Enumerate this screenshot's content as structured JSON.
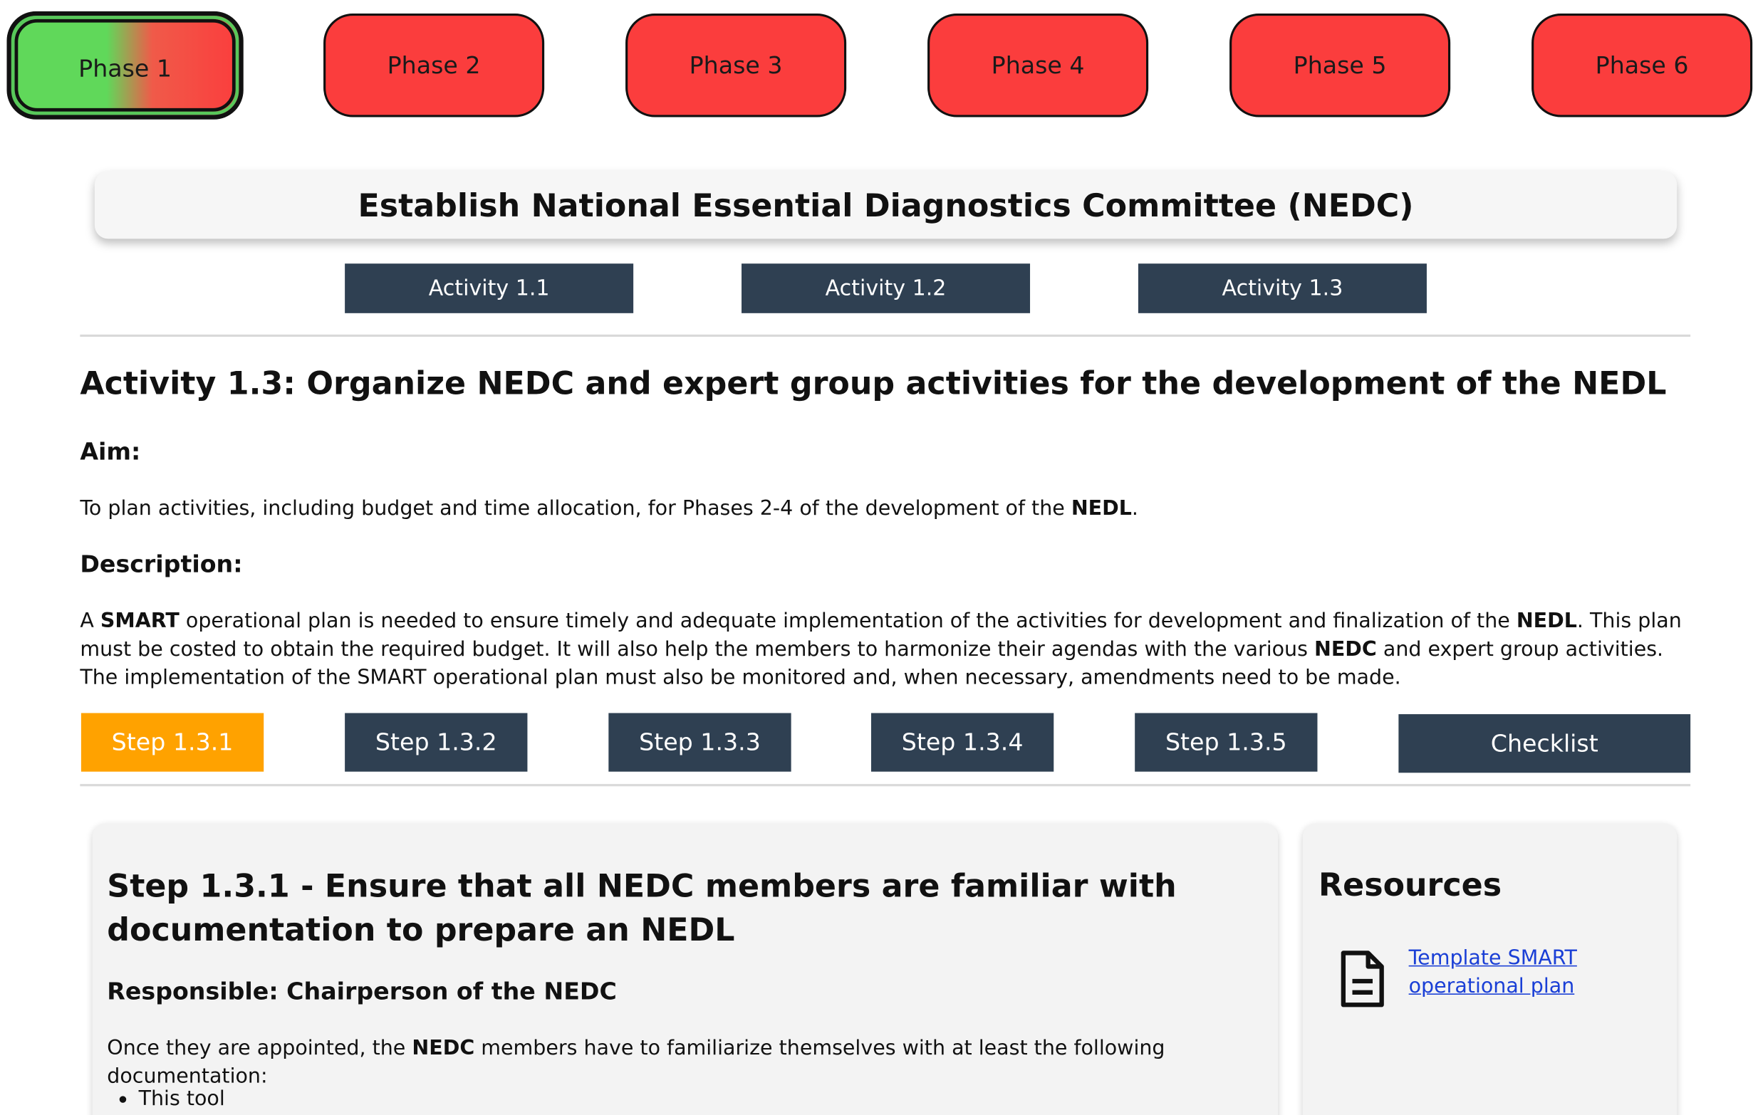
{
  "phases": [
    {
      "label": "Phase 1",
      "status": "active"
    },
    {
      "label": "Phase 2"
    },
    {
      "label": "Phase 3"
    },
    {
      "label": "Phase 4"
    },
    {
      "label": "Phase 5"
    },
    {
      "label": "Phase 6"
    }
  ],
  "colors": {
    "phase_pending": "#fb3d3d",
    "phase_done": "#60d85a",
    "nav_button": "#2f4052",
    "active_step": "#ffa200",
    "link": "#1a3fd6"
  },
  "header": {
    "title": "Establish National Essential Diagnostics Committee (NEDC)"
  },
  "activities": [
    {
      "label": "Activity 1.1"
    },
    {
      "label": "Activity 1.2"
    },
    {
      "label": "Activity 1.3"
    }
  ],
  "activity": {
    "heading": "Activity 1.3: Organize NEDC and expert group activities for the development of the NEDL",
    "aim_label": "Aim:",
    "aim_text_1": "To plan activities, including budget and time allocation, for Phases 2-4 of the development of the ",
    "aim_bold": "NEDL",
    "aim_text_2": ".",
    "description_label": "Description:",
    "desc_a": "A ",
    "desc_b": "SMART",
    "desc_c": " operational plan is needed to ensure timely and adequate implementation of the activities for development and finalization of the ",
    "desc_d": "NEDL",
    "desc_e": ". This plan must be costed to obtain the required budget. It will also help the members to harmonize their agendas with the various ",
    "desc_f": "NEDC",
    "desc_g": " and expert group activities. The implementation of the SMART operational plan must also be monitored and, when necessary, amendments need to be made."
  },
  "steps": [
    {
      "label": "Step 1.3.1",
      "status": "active"
    },
    {
      "label": "Step 1.3.2"
    },
    {
      "label": "Step 1.3.3"
    },
    {
      "label": "Step 1.3.4"
    },
    {
      "label": "Step 1.3.5"
    }
  ],
  "checklist_label": "Checklist",
  "step_detail": {
    "title": "Step 1.3.1 - Ensure that all NEDC members are familiar with documentation to prepare an NEDL",
    "responsible": "Responsible: Chairperson of the NEDC",
    "para_1": "Once they are appointed, the ",
    "para_bold": "NEDC",
    "para_2": " members have to familiarize themselves with at least the following documentation:",
    "bullets": [
      "This tool"
    ]
  },
  "resources": {
    "title": "Resources",
    "items": [
      {
        "label": "Template SMART operational plan",
        "icon": "document-icon"
      }
    ]
  }
}
